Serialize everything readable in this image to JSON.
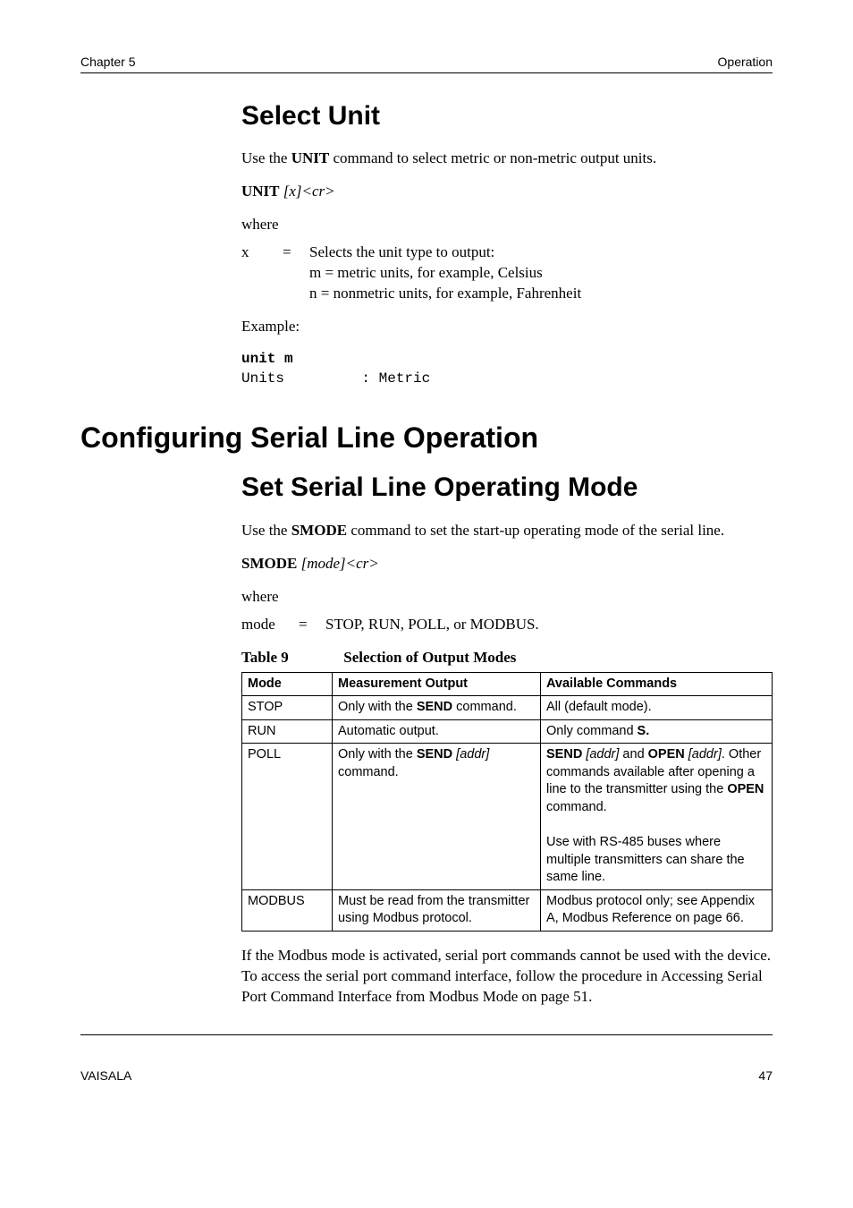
{
  "header": {
    "left": "Chapter 5",
    "rule": "____________________________________________________________________",
    "right": "Operation"
  },
  "footer": {
    "left": "VAISALA",
    "rule": "________________________________________________________________________________",
    "right": "47"
  },
  "select_unit": {
    "heading": "Select Unit",
    "intro_pre": "Use the ",
    "intro_bold": "UNIT",
    "intro_post": " command to select metric or non-metric output units.",
    "syntax_bold": "UNIT",
    "syntax_rest": " [x]<cr>",
    "where": "where",
    "def_sym": "x",
    "def_eq": "=",
    "def_l1": "Selects the unit type to output:",
    "def_l2": "m = metric units, for example, Celsius",
    "def_l3": "n = nonmetric units, for example, Fahrenheit",
    "example_label": "Example:",
    "example_line1": "unit m",
    "example_line2": "Units         : Metric"
  },
  "config": {
    "heading": "Configuring Serial Line Operation",
    "sub_heading": "Set Serial Line Operating Mode",
    "intro_pre": "Use the ",
    "intro_bold": "SMODE",
    "intro_post": " command to set the start-up operating mode of the serial line.",
    "syntax_bold": "SMODE",
    "syntax_rest": " [mode]<cr>",
    "where": "where",
    "def_sym": "mode",
    "def_eq": "=",
    "def_val": "STOP, RUN, POLL, or MODBUS.",
    "table_number": "Table 9",
    "table_title": "Selection of Output Modes",
    "table": {
      "h1": "Mode",
      "h2": "Measurement Output",
      "h3": "Available Commands",
      "rows": [
        {
          "mode": "STOP",
          "meas_pre": "Only with the ",
          "meas_bold": "SEND",
          "meas_post": " command.",
          "avail": "All (default mode)."
        },
        {
          "mode": "RUN",
          "meas_plain": "Automatic output.",
          "avail_pre": "Only command ",
          "avail_bold": "S.",
          "avail_post": ""
        },
        {
          "mode": "POLL",
          "meas_pre": "Only with the ",
          "meas_bold": "SEND",
          "meas_italic": " [addr]",
          "meas_post2": " command.",
          "poll_avail": {
            "l1b1": "SEND",
            "l1i1": " [addr]",
            "l1t1": " and ",
            "l1b2": "OPEN",
            "l1i2": " [addr]",
            "l1t2": ".",
            "l2": "Other commands available after opening a line to the transmitter using the ",
            "l2b": "OPEN",
            "l2t": " command.",
            "blank": "",
            "l3": "Use with RS-485 buses where multiple transmitters can share the same line."
          }
        },
        {
          "mode": "MODBUS",
          "meas_plain": "Must be read from the transmitter using Modbus protocol.",
          "avail_plain": "Modbus protocol only; see Appendix A, Modbus Reference on page 66."
        }
      ]
    },
    "closing": "If the Modbus mode is activated, serial port commands cannot be used with the device. To access the serial port command interface, follow the procedure in Accessing Serial Port Command Interface from  Modbus Mode on page 51."
  }
}
